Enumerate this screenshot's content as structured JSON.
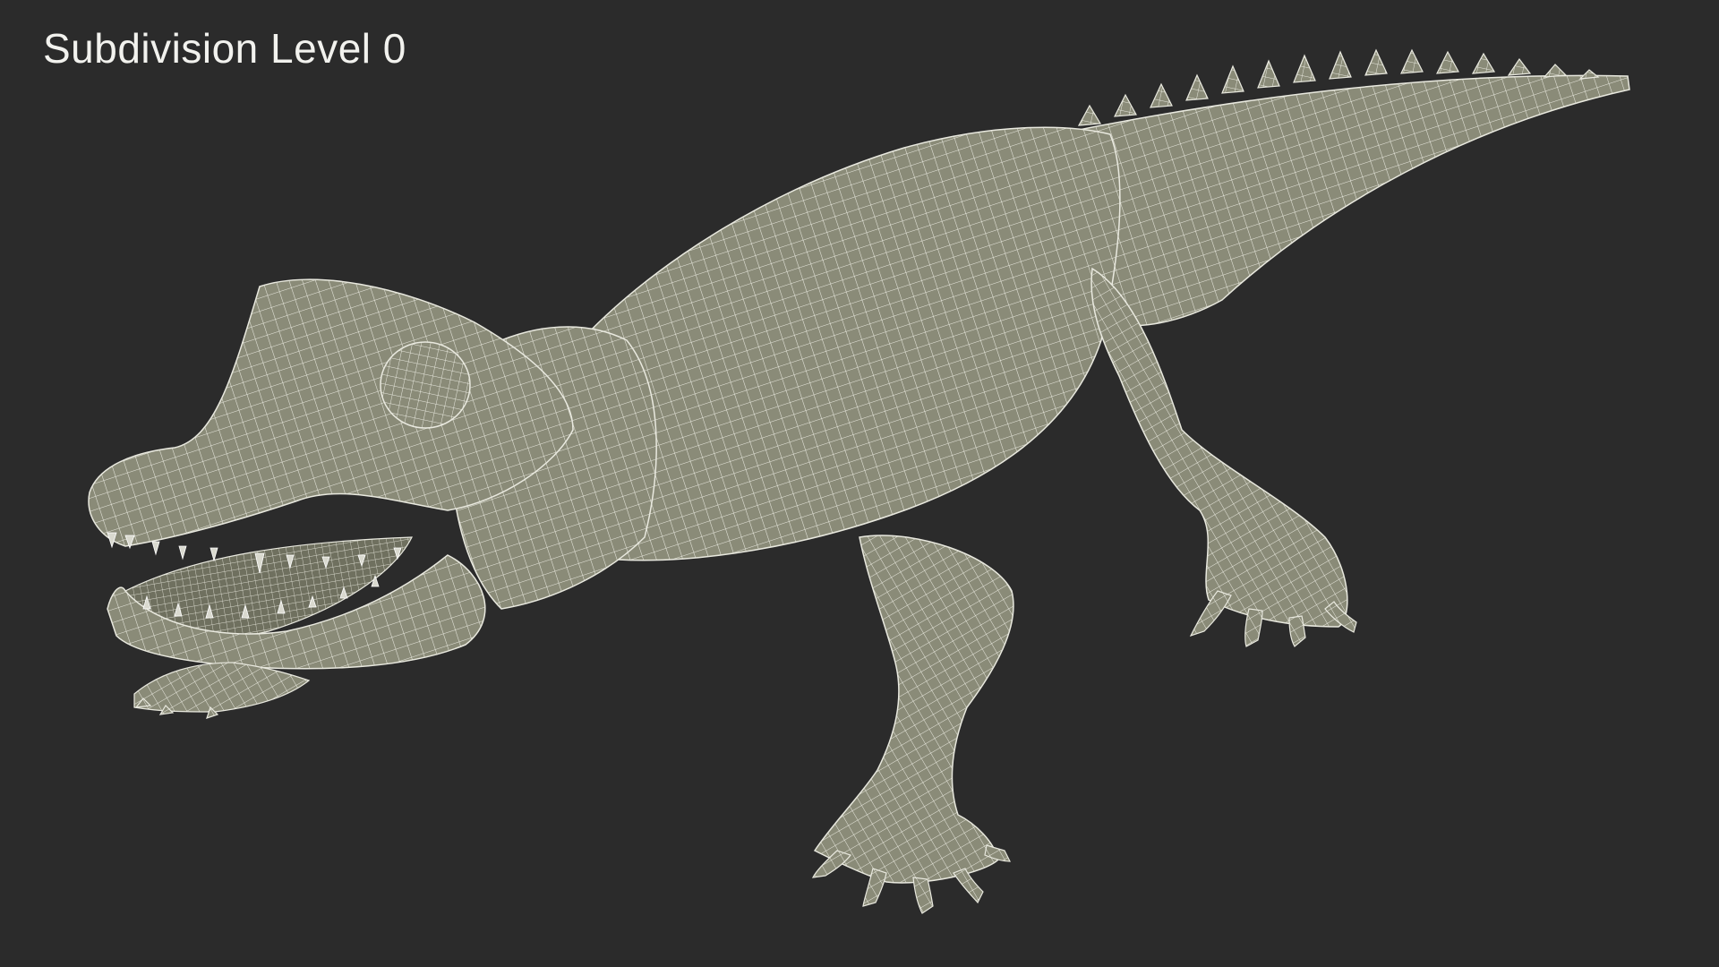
{
  "viewport": {
    "label": "Subdivision Level 0",
    "background_color": "#2b2b2b",
    "model_fill_color": "#8a8b78",
    "wire_color": "#e9e9df",
    "subject_icon": "alligator-wireframe-model"
  }
}
